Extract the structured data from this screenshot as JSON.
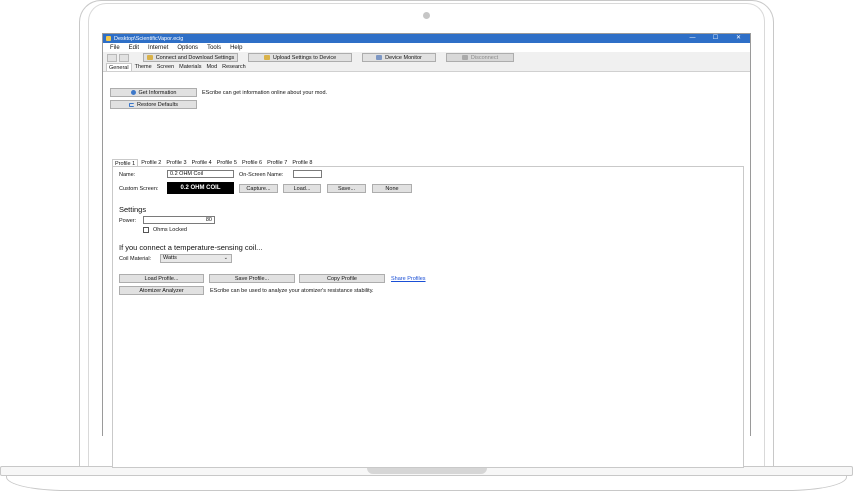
{
  "window": {
    "title": "Desktop\\ScientificVapor.ecig",
    "minimize": "—",
    "maximize": "☐",
    "close": "✕"
  },
  "menu": [
    "File",
    "Edit",
    "Internet",
    "Options",
    "Tools",
    "Help"
  ],
  "toolbar": {
    "connect": "Connect and Download Settings",
    "upload": "Upload Settings to Device",
    "monitor": "Device Monitor",
    "disconnect": "Disconnect"
  },
  "main_tabs": [
    "General",
    "Theme",
    "Screen",
    "Materials",
    "Mod",
    "Research"
  ],
  "general": {
    "get_info": "Get Information",
    "get_info_desc": "EScribe can get information online about your mod.",
    "restore": "Restore Defaults"
  },
  "profile_tabs": [
    "Profile 1",
    "Profile 2",
    "Profile 3",
    "Profile 4",
    "Profile 5",
    "Profile 6",
    "Profile 7",
    "Profile 8"
  ],
  "profile": {
    "name_label": "Name:",
    "name_value": "0.2 OHM Coil",
    "onscreen_label": "On-Screen Name:",
    "onscreen_value": "",
    "custom_screen_label": "Custom Screen:",
    "preview_text": "0.2 OHM COIL",
    "capture": "Capture...",
    "load": "Load...",
    "save": "Save...",
    "none": "None",
    "settings_heading": "Settings",
    "power_label": "Power:",
    "power_value": "80",
    "ohms_locked": "Ohms Locked",
    "temp_heading": "If you connect a temperature-sensing coil...",
    "coil_label": "Coil Material:",
    "coil_value": "Watts",
    "load_profile": "Load Profile...",
    "save_profile": "Save Profile...",
    "copy_profile": "Copy Profile",
    "share_profiles": "Share Profiles",
    "atomizer": "Atomizer Analyzer",
    "atomizer_desc": "EScribe can be used to analyze your atomizer's resistance stability."
  }
}
